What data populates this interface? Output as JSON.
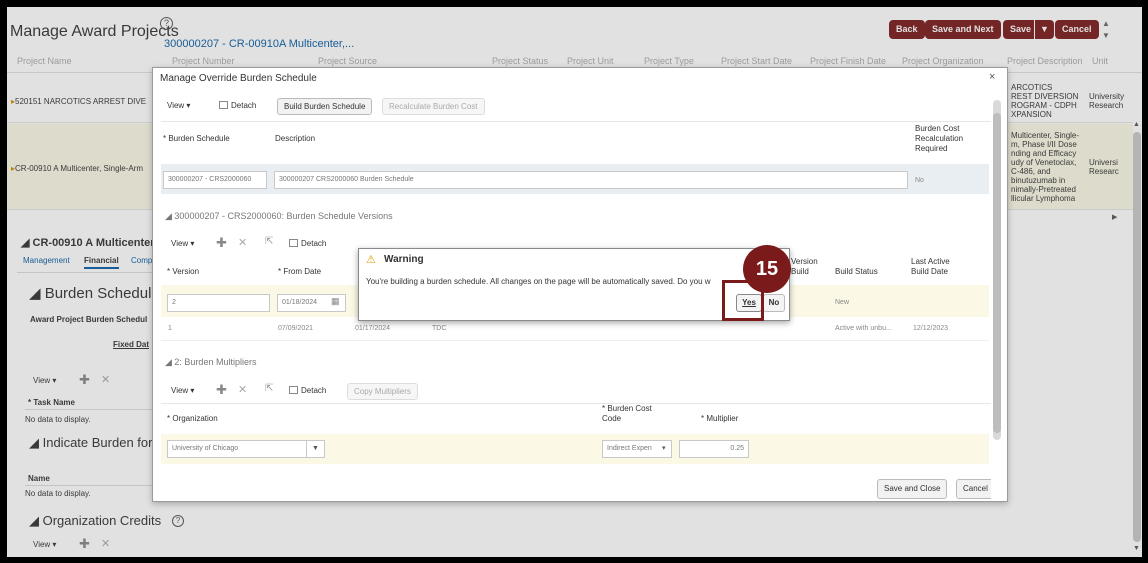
{
  "page": {
    "title": "Manage Award Projects",
    "subtitle": "300000207 - CR-00910A Multicenter,...",
    "buttons": {
      "back": "Back",
      "save_next": "Save and Next",
      "save": "Save",
      "save_menu": "▼",
      "cancel": "Cancel"
    }
  },
  "bg_table": {
    "headers": [
      "Project Name",
      "Project Number",
      "Project Source",
      "Project Status",
      "Project Unit",
      "Project Type",
      "Project Start Date",
      "Project Finish Date",
      "Project Organization",
      "Project Description",
      "Unit"
    ],
    "row1": {
      "name": "520151 NARCOTICS ARREST DIVE",
      "desc": [
        "ARCOTICS",
        "REST DIVERSION",
        "ROGRAM - CDPH",
        "XPANSION"
      ],
      "org": [
        "University",
        "Research"
      ]
    },
    "row2": {
      "name": "CR-00910 A Multicenter, Single-Arm",
      "desc": [
        "Multicenter, Single-",
        "m, Phase I/II Dose",
        "nding and Efficacy",
        "udy of Venetoclax,",
        "C-486, and",
        "binutuzumab in",
        "nimally-Pretreated",
        "llicular Lymphoma"
      ],
      "org": [
        "Universi",
        "Researc"
      ]
    }
  },
  "lower": {
    "title": "CR-00910 A Multicenter, S",
    "tabs": [
      "Management",
      "Financial",
      "Comp"
    ],
    "burden_schedule_title": "Burden Schedule",
    "award_project_burden": "Award Project Burden Schedul",
    "fixed_date": "Fixed Dat",
    "view_label": "View",
    "task_name": "Task Name",
    "no_data": "No data to display.",
    "indicate_burden": "Indicate Burden for",
    "name_label": "Name",
    "org_credits": "Organization Credits"
  },
  "dialog": {
    "title": "Manage Override Burden Schedule",
    "close": "×",
    "toolbar": {
      "view": "View",
      "detach": "Detach",
      "build": "Build Burden Schedule",
      "recalc": "Recalculate Burden Cost"
    },
    "cols": {
      "burden_schedule": "Burden Schedule",
      "description": "Description",
      "recalc_required": [
        "Burden Cost",
        "Recalculation",
        "Required"
      ]
    },
    "row": {
      "schedule": "300000207 - CRS2000060",
      "description": "300000207 CRS2000060 Burden Schedule",
      "recalc": "No"
    },
    "versions": {
      "title": "300000207 - CRS2000060: Burden Schedule Versions",
      "view": "View",
      "detach": "Detach",
      "cols": {
        "version": "Version",
        "from_date": "From Date",
        "version_build": [
          "Version",
          "Build"
        ],
        "build_status": "Build Status",
        "last_active": [
          "Last Active",
          "Build Date"
        ]
      },
      "rows": [
        {
          "version": "2",
          "from": "01/18/2024",
          "status": "New",
          "last": ""
        },
        {
          "version": "1",
          "from": "07/09/2021",
          "to": "01/17/2024",
          "type": "TDC",
          "status": "Active with unbu...",
          "last": "12/12/2023"
        }
      ]
    },
    "multipliers": {
      "title": "2: Burden Multipliers",
      "view": "View",
      "detach": "Detach",
      "copy": "Copy Multipliers",
      "cols": {
        "organization": "Organization",
        "cost_code": [
          "Burden Cost",
          "Code"
        ],
        "multiplier": "Multiplier"
      },
      "row": {
        "organization": "University of Chicago",
        "cost_code": "Indirect Expen",
        "multiplier": "0.25"
      }
    },
    "footer": {
      "save_close": "Save and Close",
      "cancel": "Cancel"
    }
  },
  "warning": {
    "title": "Warning",
    "message": "You're building a burden schedule. All changes on the page will be automatically saved. Do you w",
    "yes": "Yes",
    "no": "No"
  },
  "step_badge": "15",
  "colors": {
    "brand": "#7a1a1a",
    "link": "#0b5fa5",
    "warn": "#e0a000"
  }
}
